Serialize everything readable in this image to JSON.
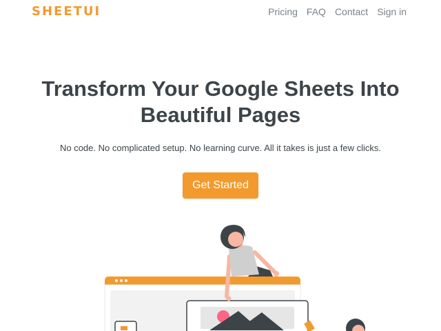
{
  "nav": {
    "logo": "SHEETUI",
    "links": [
      "Pricing",
      "FAQ",
      "Contact",
      "Sign in"
    ]
  },
  "hero": {
    "title_line1": "Transform Your Google Sheets Into",
    "title_line2": "Beautiful Pages",
    "subtitle": "No code. No complicated setup. No learning curve. All it takes is just a few clicks.",
    "cta_label": "Get Started"
  },
  "colors": {
    "accent": "#f29a2e",
    "heading": "#3d4449",
    "nav_link": "#7b8388"
  },
  "illustration": {
    "icons": [
      "person-on-browser-illustration",
      "image-placeholder-icon",
      "folder-icon"
    ]
  }
}
